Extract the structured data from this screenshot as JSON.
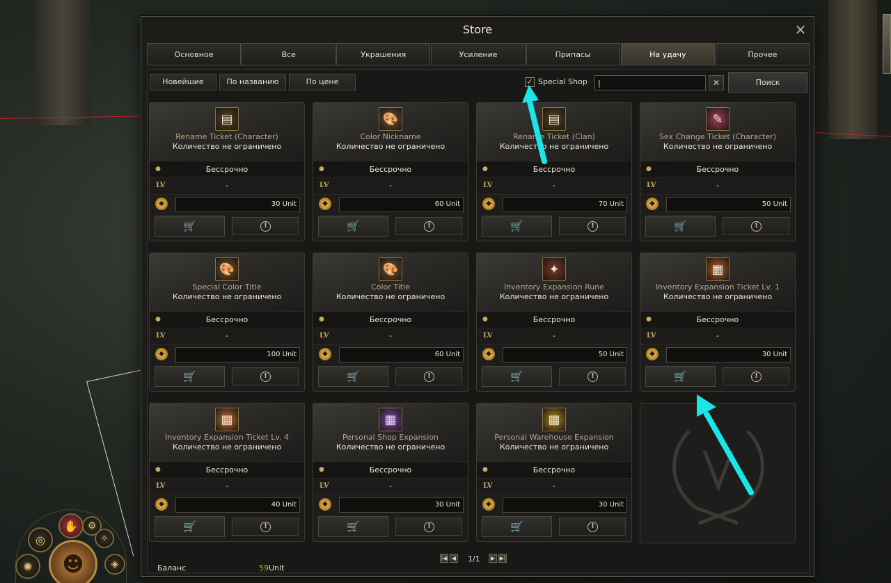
{
  "window": {
    "title": "Store",
    "close_icon": "×"
  },
  "tabs": [
    {
      "label": "Основное",
      "active": false
    },
    {
      "label": "Все",
      "active": false
    },
    {
      "label": "Украшения",
      "active": false
    },
    {
      "label": "Усиление",
      "active": false
    },
    {
      "label": "Припасы",
      "active": false
    },
    {
      "label": "На удачу",
      "active": true
    },
    {
      "label": "Прочее",
      "active": false
    }
  ],
  "sort": {
    "newest": "Новейшие",
    "by_name": "По названию",
    "by_price": "По цене"
  },
  "filter": {
    "special_shop_label": "Special Shop",
    "special_shop_checked": true,
    "check_mark": "✓",
    "search_value": "|",
    "search_button": "Поиск",
    "clear_icon": "✕"
  },
  "card_common": {
    "quantity": "Количество не ограничено",
    "duration": "Бессрочно",
    "duration_icon": "●",
    "level_icon": "LV",
    "level": "-",
    "coin_icon": "◆",
    "cart_icon": "🛒",
    "info_icon": "!"
  },
  "items": [
    {
      "name": "Rename Ticket (Character)",
      "price": "30 Unit",
      "icon": "rename-ticket-icon",
      "glyph": "▤",
      "bg": "#5a4420"
    },
    {
      "name": "Color Nickname",
      "price": "60 Unit",
      "icon": "palette-icon",
      "glyph": "🎨",
      "bg": "#6a5230"
    },
    {
      "name": "Rename Ticket (Clan)",
      "price": "70 Unit",
      "icon": "rename-ticket-icon",
      "glyph": "▤",
      "bg": "#5a4420"
    },
    {
      "name": "Sex Change Ticket (Character)",
      "price": "50 Unit",
      "icon": "pink-ticket-icon",
      "glyph": "✎",
      "bg": "#a0405a"
    },
    {
      "name": "Special Color Title",
      "price": "100 Unit",
      "icon": "palette-icon",
      "glyph": "🎨",
      "bg": "#6a5230"
    },
    {
      "name": "Color Title",
      "price": "60 Unit",
      "icon": "palette-icon",
      "glyph": "🎨",
      "bg": "#6a5230"
    },
    {
      "name": "Inventory Expansion Rune",
      "price": "50 Unit",
      "icon": "rune-icon",
      "glyph": "✦",
      "bg": "#7a3a22"
    },
    {
      "name": "Inventory Expansion Ticket Lv. 1",
      "price": "30 Unit",
      "icon": "expansion-ticket-icon",
      "glyph": "▦",
      "bg": "#b0602a"
    },
    {
      "name": "Inventory Expansion Ticket Lv. 4",
      "price": "40 Unit",
      "icon": "expansion-ticket-icon",
      "glyph": "▦",
      "bg": "#c0702e"
    },
    {
      "name": "Personal Shop Expansion",
      "price": "30 Unit",
      "icon": "purple-ticket-icon",
      "glyph": "▦",
      "bg": "#7a48b0"
    },
    {
      "name": "Personal Warehouse Expansion",
      "price": "30 Unit",
      "icon": "gold-ticket-icon",
      "glyph": "▦",
      "bg": "#b08a1c"
    }
  ],
  "footer": {
    "balance_label": "Баланс",
    "balance_amount": "59",
    "balance_unit": "Unit",
    "page": "1/1",
    "first_icon": "|◀",
    "prev_icon": "◀",
    "next_icon": "▶",
    "last_icon": "▶|"
  },
  "colors": {
    "arrow": "#19e6e6",
    "balance": "#7ad43a",
    "accent_gold": "#c9a862"
  }
}
